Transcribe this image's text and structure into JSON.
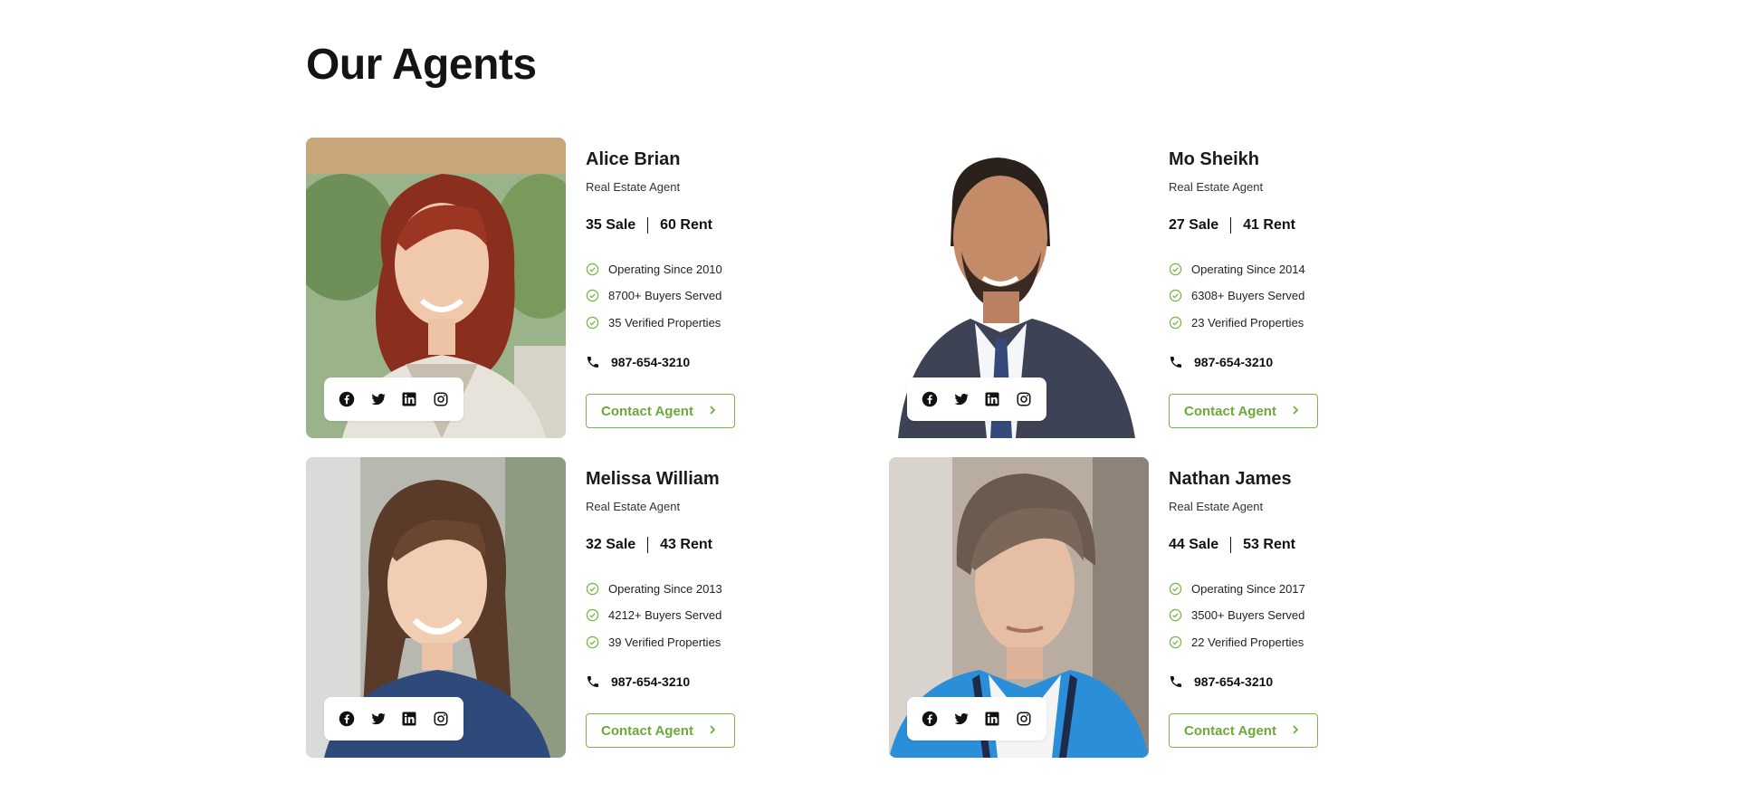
{
  "page": {
    "title": "Our Agents"
  },
  "colors": {
    "accent": "#7ab648",
    "text": "#111111"
  },
  "agents": [
    {
      "name": "Alice Brian",
      "role": "Real Estate Agent",
      "sale": "35 Sale",
      "rent": "60 Rent",
      "features": [
        "Operating Since 2010",
        "8700+ Buyers Served",
        "35 Verified Properties"
      ],
      "phone": "987-654-3210",
      "contact_label": "Contact Agent",
      "social_icons": [
        "facebook-icon",
        "twitter-icon",
        "linkedin-icon",
        "instagram-icon"
      ]
    },
    {
      "name": "Mo Sheikh",
      "role": "Real Estate Agent",
      "sale": "27 Sale",
      "rent": "41 Rent",
      "features": [
        "Operating Since 2014",
        "6308+ Buyers Served",
        "23 Verified Properties"
      ],
      "phone": "987-654-3210",
      "contact_label": "Contact Agent",
      "social_icons": [
        "facebook-icon",
        "twitter-icon",
        "linkedin-icon",
        "instagram-icon"
      ]
    },
    {
      "name": "Melissa William",
      "role": "Real Estate Agent",
      "sale": "32 Sale",
      "rent": "43 Rent",
      "features": [
        "Operating Since 2013",
        "4212+ Buyers Served",
        "39 Verified Properties"
      ],
      "phone": "987-654-3210",
      "contact_label": "Contact Agent",
      "social_icons": [
        "facebook-icon",
        "twitter-icon",
        "linkedin-icon",
        "instagram-icon"
      ]
    },
    {
      "name": "Nathan James",
      "role": "Real Estate Agent",
      "sale": "44 Sale",
      "rent": "53 Rent",
      "features": [
        "Operating Since 2017",
        "3500+ Buyers Served",
        "22 Verified Properties"
      ],
      "phone": "987-654-3210",
      "contact_label": "Contact Agent",
      "social_icons": [
        "facebook-icon",
        "twitter-icon",
        "linkedin-icon",
        "instagram-icon"
      ]
    }
  ]
}
